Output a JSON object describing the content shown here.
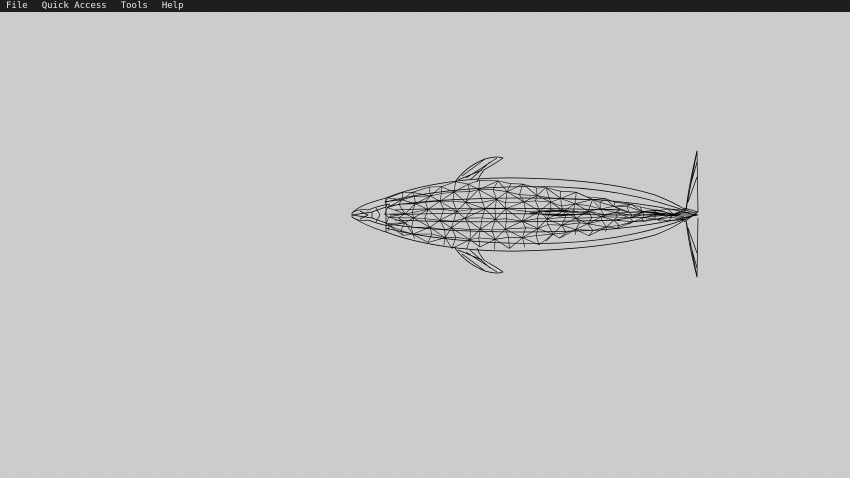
{
  "menubar": {
    "items": [
      {
        "label": "File"
      },
      {
        "label": "Quick Access"
      },
      {
        "label": "Tools"
      },
      {
        "label": "Help"
      }
    ]
  },
  "viewport": {
    "background_color": "#cdcdcd",
    "model": {
      "subject": "dolphin",
      "render_mode": "wireframe",
      "wire_color": "#000000"
    }
  }
}
